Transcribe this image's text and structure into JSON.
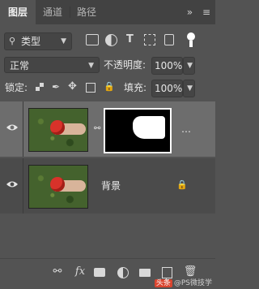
{
  "tabs": [
    {
      "label": "图层"
    },
    {
      "label": "通道"
    },
    {
      "label": "路径"
    }
  ],
  "tabbar": {
    "collapse_glyph": "»",
    "menu_glyph": "≡"
  },
  "filter": {
    "label": "类型"
  },
  "blend": {
    "mode": "正常",
    "opacity_label": "不透明度:",
    "opacity_value": "100%"
  },
  "lock": {
    "label": "锁定:",
    "fill_label": "填充:",
    "fill_value": "100%"
  },
  "layers": [
    {
      "name": "",
      "has_mask": true,
      "more_glyph": "…"
    },
    {
      "name": "背景",
      "has_mask": false
    }
  ],
  "watermark": {
    "brand": "头条",
    "handle": "@PS微技学"
  }
}
